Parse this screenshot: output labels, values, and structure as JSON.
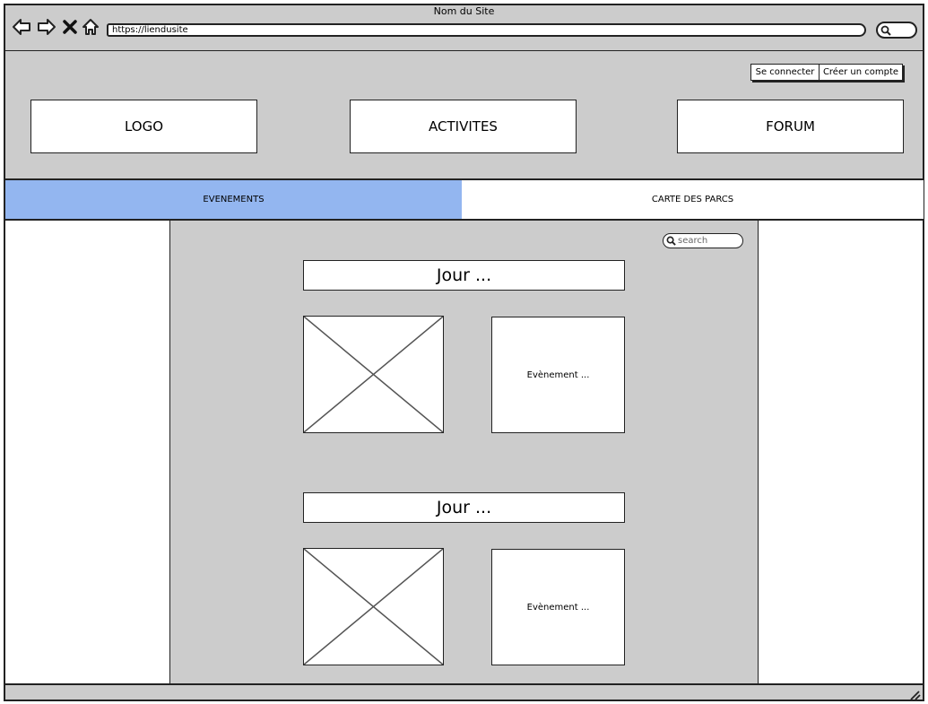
{
  "browser": {
    "site_title": "Nom du Site",
    "url": "https://liendusite",
    "nav_icons": [
      "back-icon",
      "forward-icon",
      "close-icon",
      "home-icon"
    ]
  },
  "header": {
    "login_label": "Se connecter",
    "signup_label": "Créer un compte",
    "logo_label": "LOGO",
    "activities_label": "ACTIVITES",
    "forum_label": "FORUM"
  },
  "tabs": [
    {
      "label": "EVENEMENTS",
      "active": true
    },
    {
      "label": "CARTE DES PARCS",
      "active": false
    }
  ],
  "content": {
    "search_placeholder": "search",
    "days": [
      {
        "title": "Jour ...",
        "event_label": "Evènement ..."
      },
      {
        "title": "Jour ...",
        "event_label": "Evènement ..."
      }
    ]
  },
  "colors": {
    "frame_gray": "#cccccc",
    "active_tab": "#93b6f0",
    "border": "#222222"
  }
}
